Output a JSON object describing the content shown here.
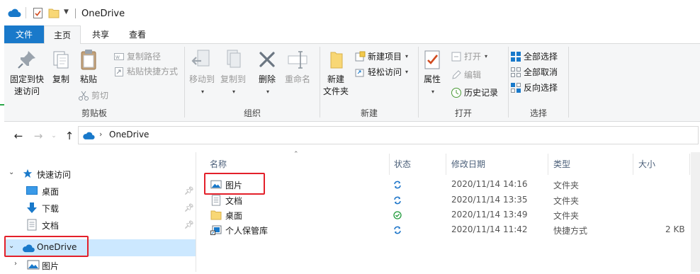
{
  "window": {
    "title": "OneDrive"
  },
  "colors": {
    "accent": "#1979ca",
    "selection": "#cce8ff",
    "highlight_box": "#e3202a",
    "sync_blue": "#1a73c8",
    "synced_green": "#1f9a3a"
  },
  "tabs": {
    "file": "文件",
    "home": "主页",
    "share": "共享",
    "view": "查看"
  },
  "ribbon": {
    "clipboard": {
      "label": "剪贴板",
      "pin_line1": "固定到快",
      "pin_line2": "速访问",
      "copy": "复制",
      "paste": "粘贴",
      "copy_path": "复制路径",
      "paste_shortcut": "粘贴快捷方式",
      "cut": "剪切"
    },
    "organize": {
      "label": "组织",
      "move_to": "移动到",
      "copy_to": "复制到",
      "delete": "删除",
      "rename": "重命名"
    },
    "new": {
      "label": "新建",
      "new_folder_line1": "新建",
      "new_folder_line2": "文件夹",
      "new_item": "新建项目",
      "easy_access": "轻松访问"
    },
    "open": {
      "label": "打开",
      "properties": "属性",
      "open": "打开",
      "edit": "编辑",
      "history": "历史记录"
    },
    "select": {
      "label": "选择",
      "select_all": "全部选择",
      "select_none": "全部取消",
      "invert": "反向选择"
    }
  },
  "address": {
    "path": "OneDrive"
  },
  "nav": {
    "quick_access": "快速访问",
    "desktop": "桌面",
    "downloads": "下载",
    "documents": "文档",
    "onedrive": "OneDrive",
    "pictures": "图片"
  },
  "columns": {
    "name": "名称",
    "status": "状态",
    "modified": "修改日期",
    "type": "类型",
    "size": "大小"
  },
  "files": [
    {
      "name": "图片",
      "status": "sync-icon",
      "modified": "2020/11/14 14:16",
      "type": "文件夹",
      "size": ""
    },
    {
      "name": "文档",
      "status": "sync-icon",
      "modified": "2020/11/14 13:35",
      "type": "文件夹",
      "size": ""
    },
    {
      "name": "桌面",
      "status": "synced-check-icon",
      "modified": "2020/11/14 13:49",
      "type": "文件夹",
      "size": ""
    },
    {
      "name": "个人保管库",
      "status": "sync-icon",
      "modified": "2020/11/14 11:42",
      "type": "快捷方式",
      "size": "2 KB"
    }
  ]
}
